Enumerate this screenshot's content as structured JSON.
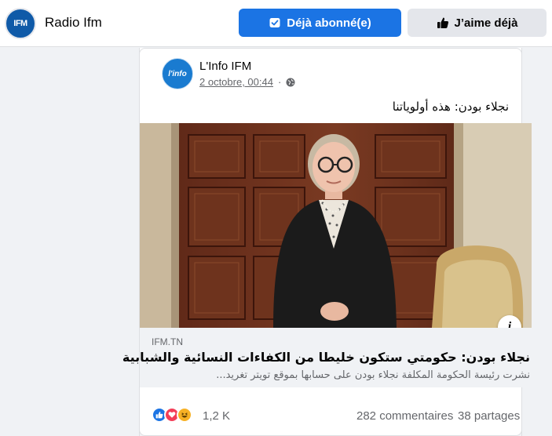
{
  "header": {
    "page_name": "Radio Ifm",
    "logo_text": "IFM",
    "subscribed_label": "Déjà abonné(e)",
    "like_label": "J’aime déjà"
  },
  "post": {
    "author": "L'Info IFM",
    "avatar_text": "l'info",
    "date": "2 octobre, 00:44",
    "separator": "·",
    "text": "نجلاء بودن: هذه أولوياتنا"
  },
  "link_preview": {
    "domain": "IFM.TN",
    "title": "نجلاء بودن: حكومتي ستكون خليطا من الكفاءات النسائية والشبابية",
    "description": "نشرت رئيسة الحكومة المكلفة نجلاء بودن على حسابها بموقع تويتر تغريد...",
    "info_icon": "i"
  },
  "stats": {
    "reactions_count": "1,2 K",
    "comments": "282 commentaires",
    "shares": "38 partages"
  },
  "colors": {
    "primary": "#1b74e4",
    "background": "#f0f2f5",
    "secondary_text": "#65676b"
  }
}
